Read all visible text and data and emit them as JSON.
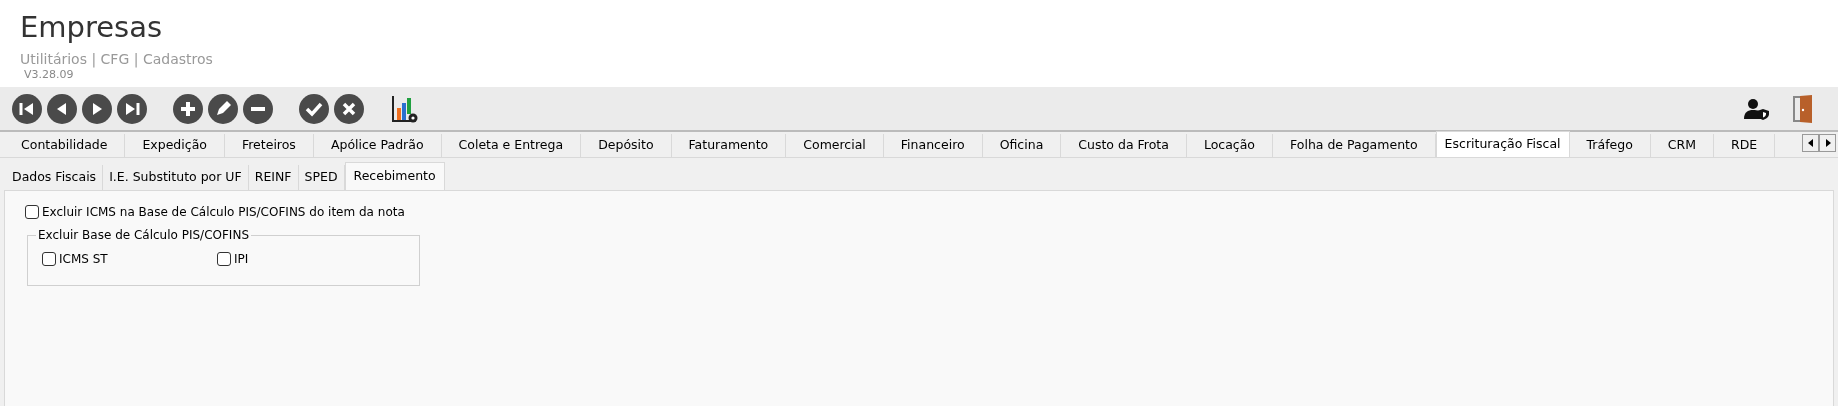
{
  "header": {
    "title": "Empresas",
    "breadcrumb": "Utilitários | CFG | Cadastros",
    "version": "V3.28.09"
  },
  "tabs": [
    {
      "label": "Contabilidade",
      "selected": false
    },
    {
      "label": "Expedição",
      "selected": false
    },
    {
      "label": "Freteiros",
      "selected": false
    },
    {
      "label": "Apólice Padrão",
      "selected": false
    },
    {
      "label": "Coleta e Entrega",
      "selected": false
    },
    {
      "label": "Depósito",
      "selected": false
    },
    {
      "label": "Faturamento",
      "selected": false
    },
    {
      "label": "Comercial",
      "selected": false
    },
    {
      "label": "Financeiro",
      "selected": false
    },
    {
      "label": "Oficina",
      "selected": false
    },
    {
      "label": "Custo da Frota",
      "selected": false
    },
    {
      "label": "Locação",
      "selected": false
    },
    {
      "label": "Folha de Pagamento",
      "selected": false
    },
    {
      "label": "Escrituração Fiscal",
      "selected": true
    },
    {
      "label": "Tráfego",
      "selected": false
    },
    {
      "label": "CRM",
      "selected": false
    },
    {
      "label": "RDE",
      "selected": false
    }
  ],
  "subtabs": [
    {
      "label": "Dados Fiscais",
      "selected": false
    },
    {
      "label": "I.E. Substituto por UF",
      "selected": false
    },
    {
      "label": "REINF",
      "selected": false
    },
    {
      "label": "SPED",
      "selected": false
    },
    {
      "label": "Recebimento",
      "selected": true
    }
  ],
  "options": {
    "main": {
      "label": "Excluir ICMS na Base de Cálculo PIS/COFINS do item da nota",
      "checked": false
    },
    "group": {
      "title": "Excluir Base de Cálculo PIS/COFINS",
      "items": [
        {
          "label": "ICMS ST",
          "checked": false
        },
        {
          "label": "IPI",
          "checked": false
        }
      ]
    }
  }
}
